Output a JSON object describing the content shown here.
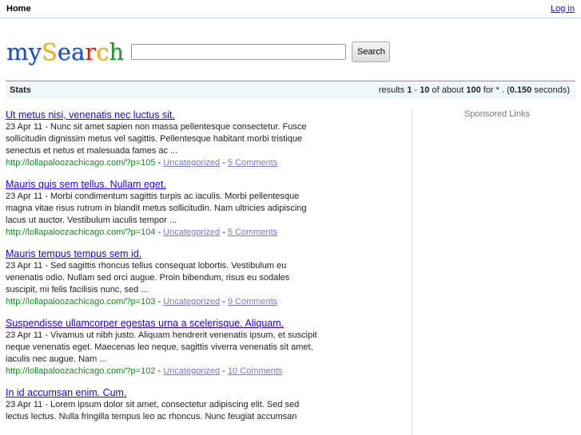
{
  "header": {
    "home": "Home",
    "login": "Log in"
  },
  "logo": {
    "letters": [
      {
        "ch": "m",
        "color": "#1a4fc7"
      },
      {
        "ch": "y",
        "color": "#1a4fc7"
      },
      {
        "ch": "S",
        "color": "#e8b90e"
      },
      {
        "ch": "e",
        "color": "#1a4fc7"
      },
      {
        "ch": "a",
        "color": "#1a4fc7"
      },
      {
        "ch": "r",
        "color": "#d02a1e"
      },
      {
        "ch": "c",
        "color": "#e8b90e"
      },
      {
        "ch": "h",
        "color": "#1c9a2c"
      }
    ]
  },
  "search": {
    "value": "",
    "button": "Search"
  },
  "stats": {
    "label": "Stats",
    "prefix": "results ",
    "from": "1",
    "dash": " - ",
    "to": "10",
    "of": " of about ",
    "total": "100",
    "for": " for * . (",
    "time": "0.150",
    "suffix": " seconds)"
  },
  "results": [
    {
      "title": "Ut metus nisi, venenatis nec luctus sit.",
      "snippet": "23 Apr 11 - Nunc sit amet sapien non massa pellentesque consectetur. Fusce sollicitudin dignissim metus vel sagittis. Pellentesque habitant morbi tristique senectus et netus et malesuada fames ac ...",
      "url": "http://lollapaloozachicago.com/?p=105",
      "category": "Uncategorized",
      "comments": "5 Comments"
    },
    {
      "title": "Mauris quis sem tellus. Nullam eget.",
      "snippet": "23 Apr 11 - Morbi condimentum sagittis turpis ac iaculis. Morbi pellentesque magna vitae risus rutrum in blandit metus sollicitudin. Nam ultricies adipiscing lacus ut auctor. Vestibulum iaculis tempor ...",
      "url": "http://lollapaloozachicago.com/?p=104",
      "category": "Uncategorized",
      "comments": "5 Comments"
    },
    {
      "title": "Mauris tempus tempus sem id.",
      "snippet": "23 Apr 11 - Sed sagittis rhoncus tellus consequat lobortis. Vestibulum eu venenatis odio. Nullam sed orci augue. Proin bibendum, risus eu sodales suscipit, mi felis facilisis nunc, sed ...",
      "url": "http://lollapaloozachicago.com/?p=103",
      "category": "Uncategorized",
      "comments": "9 Comments"
    },
    {
      "title": "Suspendisse ullamcorper egestas urna a scelerisque. Aliquam.",
      "snippet": "23 Apr 11 - Vivamus ut nibh justo. Aliquam hendrerit venenatis ipsum, et suscipit neque venenatis eget. Maecenas leo neque, sagittis viverra venenatis sit amet, iaculis nec augue. Nam ...",
      "url": "http://lollapaloozachicago.com/?p=102",
      "category": "Uncategorized",
      "comments": "10 Comments"
    },
    {
      "title": "In id accumsan enim. Cum.",
      "snippet": "23 Apr 11 - Lorem ipsum dolor sit amet, consectetur adipiscing elit. Sed sed lectus lectus. Nulla fringilla tempus leo ac rhoncus. Nunc feugiat accumsan",
      "url": "",
      "category": "",
      "comments": ""
    }
  ],
  "sidebar": {
    "sponsored": "Sponsored Links"
  }
}
